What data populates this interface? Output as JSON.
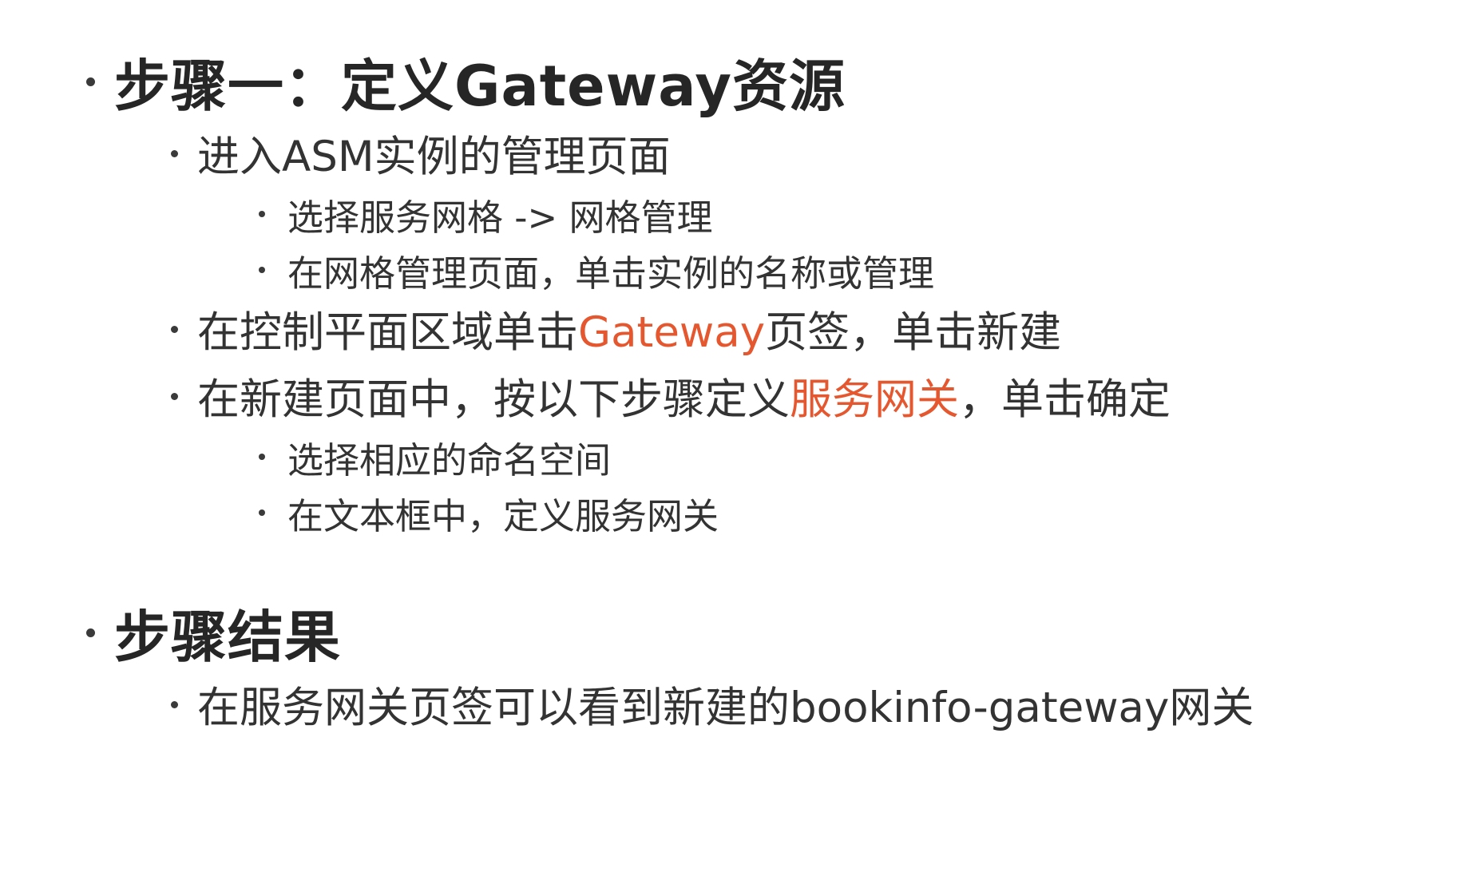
{
  "colors": {
    "text": "#333333",
    "heading": "#262626",
    "highlight": "#e5572f",
    "background": "#ffffff"
  },
  "sections": [
    {
      "heading": "步骤一：定义Gateway资源",
      "items": [
        {
          "text": "进入ASM实例的管理页面",
          "subitems": [
            "选择服务网格 -> 网格管理",
            "在网格管理页面，单击实例的名称或管理"
          ]
        },
        {
          "pre": "在控制平面区域单击",
          "highlight": "Gateway",
          "post": "页签，单击新建"
        },
        {
          "pre": "在新建页面中，按以下步骤定义",
          "highlight": "服务网关",
          "post": "，单击确定",
          "subitems": [
            "选择相应的命名空间",
            "在文本框中，定义服务网关"
          ]
        }
      ]
    },
    {
      "heading": "步骤结果",
      "items": [
        {
          "text": "在服务网关页签可以看到新建的bookinfo-gateway网关"
        }
      ]
    }
  ]
}
